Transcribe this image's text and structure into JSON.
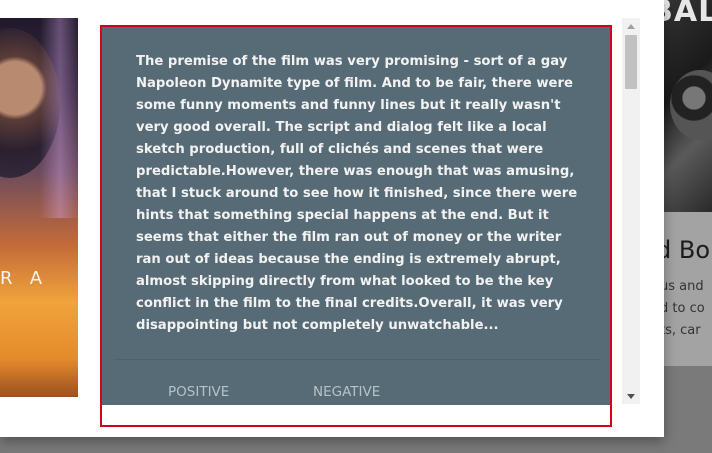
{
  "background": {
    "right_card": {
      "poster_title_fragment": "BAL",
      "title_fragment": "d Bo",
      "description_lines": [
        "us and",
        "d to co",
        "ts, car"
      ]
    }
  },
  "dialog": {
    "poster": {
      "letters": "RA"
    },
    "review": {
      "text": "The premise of the film was very promising - sort of a gay Napoleon Dynamite type of film. And to be fair, there were some funny moments and funny lines but it really wasn't very good overall. The script and dialog felt like a local sketch production, full of clichés and scenes that were predictable.However, there was enough that was amusing, that I stuck around to see how it finished, since there were hints that something special happens at the end. But it seems that either the film ran out of money or the writer ran out of ideas because the ending is extremely abrupt, almost skipping directly from what looked to be the key conflict in the film to the final credits.Overall, it was very disappointing but not completely unwatchable..."
    },
    "actions": {
      "positive_label": "POSITIVE",
      "negative_label": "NEGATIVE"
    },
    "colors": {
      "card_background": "#566b75",
      "highlight_border": "#d0021b"
    }
  }
}
